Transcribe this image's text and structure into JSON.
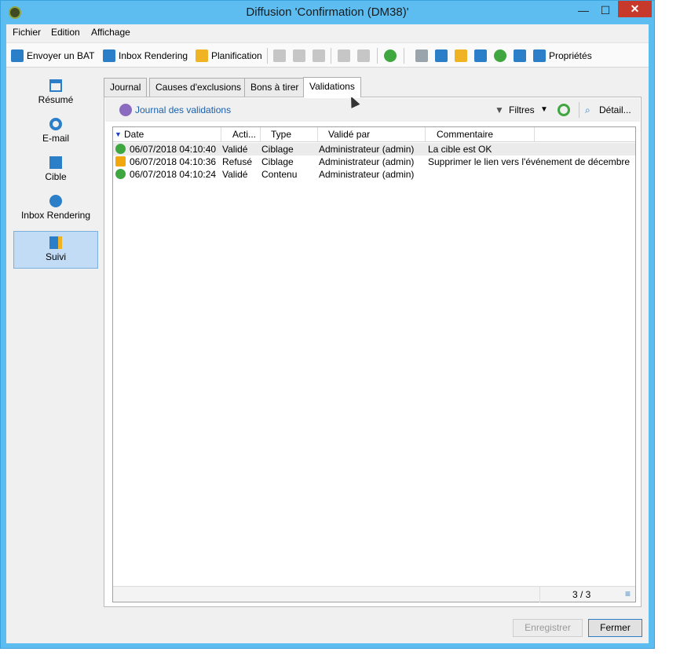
{
  "window": {
    "title": "Diffusion 'Confirmation (DM38)'",
    "minimize": "—",
    "maximize": "☐",
    "close": "✕"
  },
  "menu": [
    "Fichier",
    "Edition",
    "Affichage"
  ],
  "toolbar": {
    "send_bat": "Envoyer un BAT",
    "inbox_rendering": "Inbox Rendering",
    "planification": "Planification",
    "proprietes": "Propriétés"
  },
  "sidebar": [
    {
      "label": "Résumé",
      "icon": "summary-icon"
    },
    {
      "label": "E-mail",
      "icon": "email-icon"
    },
    {
      "label": "Cible",
      "icon": "target-icon"
    },
    {
      "label": "Inbox Rendering",
      "icon": "globe-icon"
    },
    {
      "label": "Suivi",
      "icon": "tracking-icon",
      "active": true
    }
  ],
  "tabs": [
    "Journal",
    "Causes d'exclusions",
    "Bons à tirer",
    "Validations"
  ],
  "subbar": {
    "title": "Journal des validations",
    "filters": "Filtres",
    "detail": "Détail..."
  },
  "grid": {
    "columns": [
      "Date",
      "Acti...",
      "Type",
      "Validé par",
      "Commentaire"
    ],
    "rows": [
      {
        "status": "ok",
        "date": "06/07/2018 04:10:40",
        "action": "Validé",
        "type": "Ciblage",
        "by": "Administrateur (admin)",
        "comment": "La cible est OK"
      },
      {
        "status": "warn",
        "date": "06/07/2018 04:10:36",
        "action": "Refusé",
        "type": "Ciblage",
        "by": "Administrateur (admin)",
        "comment": "Supprimer le lien vers l'événement de décembre"
      },
      {
        "status": "ok",
        "date": "06/07/2018 04:10:24",
        "action": "Validé",
        "type": "Contenu",
        "by": "Administrateur (admin)",
        "comment": ""
      }
    ],
    "count": "3 / 3"
  },
  "buttons": {
    "save": "Enregistrer",
    "close": "Fermer"
  },
  "colors": {
    "titlebar": "#5dbdf0",
    "active_side": "#c1dcf4",
    "close_btn": "#c7392b",
    "ok": "#3fa640",
    "warn": "#f2a80c"
  }
}
